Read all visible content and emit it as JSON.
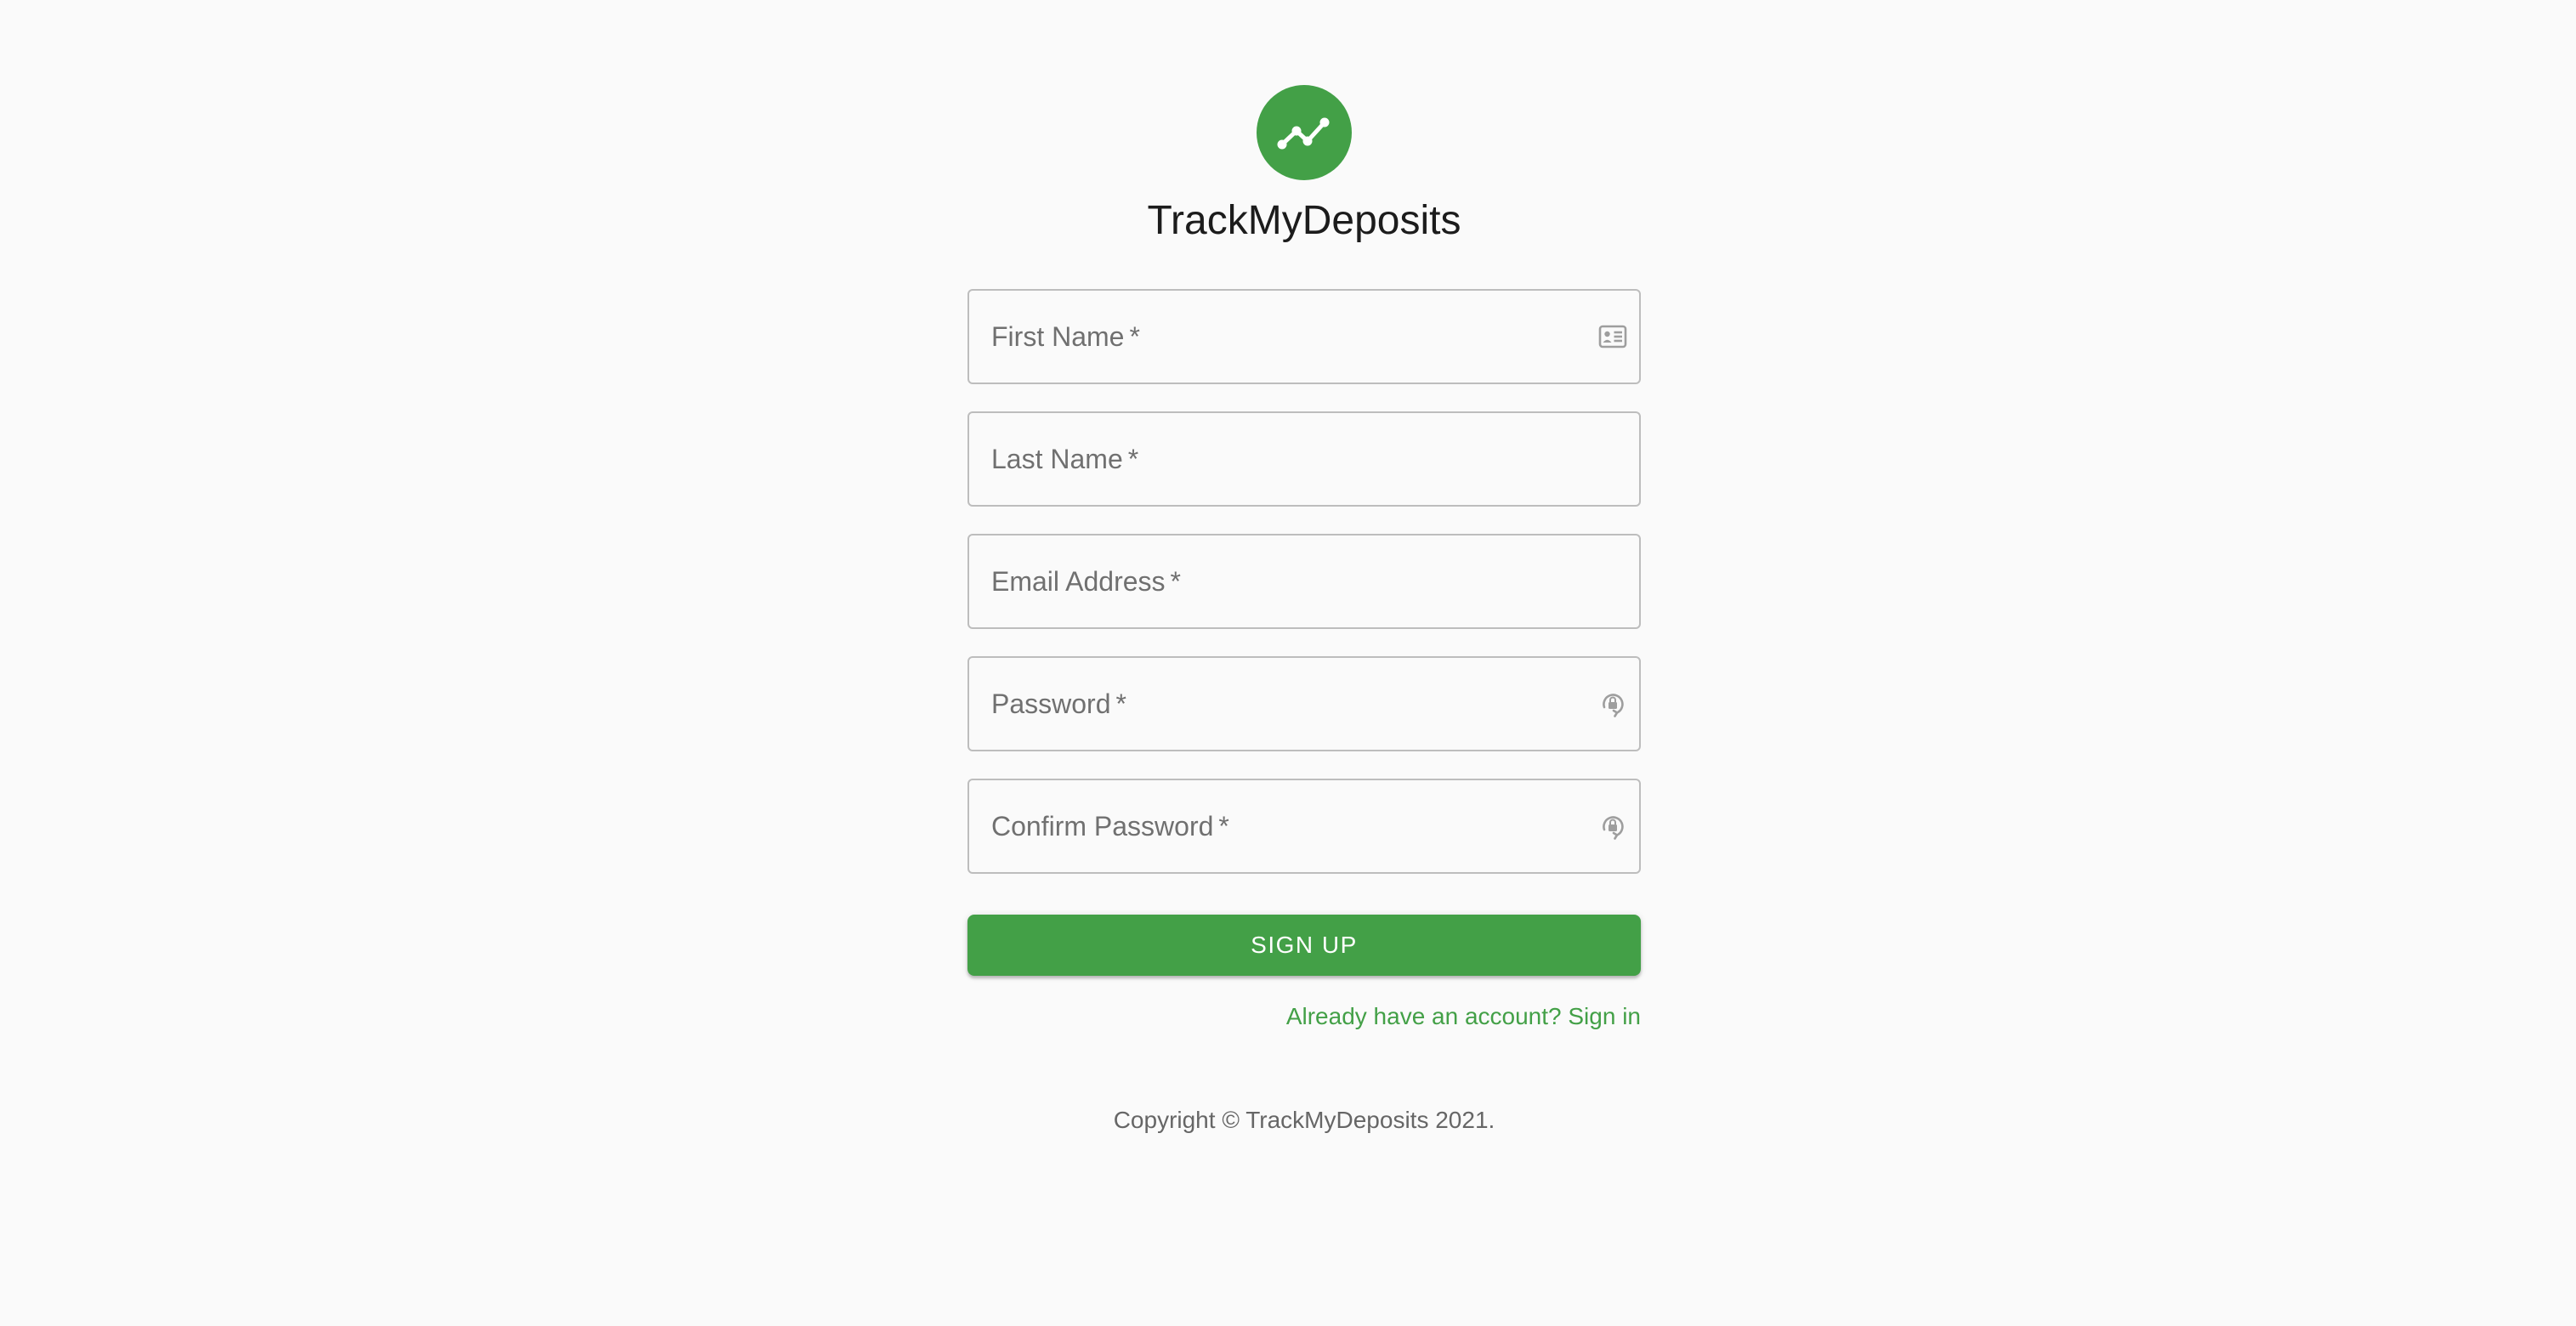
{
  "app": {
    "title": "TrackMyDeposits",
    "logo_icon": "trending-up-icon",
    "brand_color": "#43a047"
  },
  "form": {
    "fields": [
      {
        "label": "First Name",
        "required_mark": "*",
        "value": "",
        "icon": "contact-card-icon"
      },
      {
        "label": "Last Name",
        "required_mark": "*",
        "value": ""
      },
      {
        "label": "Email Address",
        "required_mark": "*",
        "value": ""
      },
      {
        "label": "Password",
        "required_mark": "*",
        "value": "",
        "icon": "password-lock-icon"
      },
      {
        "label": "Confirm Password",
        "required_mark": "*",
        "value": "",
        "icon": "password-lock-icon"
      }
    ],
    "submit_label": "SIGN UP",
    "signin_link": "Already have an account? Sign in"
  },
  "footer": {
    "copyright": "Copyright © TrackMyDeposits 2021."
  }
}
